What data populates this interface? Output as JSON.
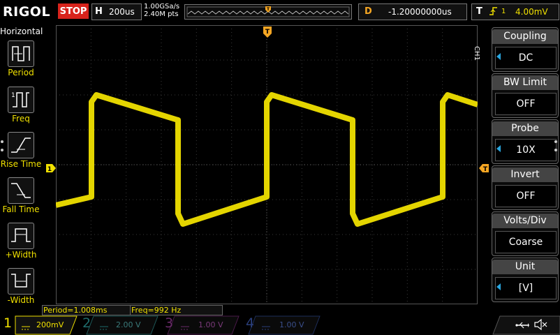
{
  "top": {
    "logo": "RIGOL",
    "run_status": "STOP",
    "timebase_key": "H",
    "timebase_value": "200us",
    "sample_rate": "1.00GSa/s",
    "memory_depth": "2.40M pts",
    "delay_key": "D",
    "delay_value": "-1.20000000us",
    "trigger_key": "T",
    "trigger_source": "1",
    "trigger_level": "4.00mV"
  },
  "left_menu": {
    "title": "Horizontal",
    "items": [
      {
        "label": "Period"
      },
      {
        "label": "Freq"
      },
      {
        "label": "Rise Time"
      },
      {
        "label": "Fall Time"
      },
      {
        "label": "+Width"
      },
      {
        "label": "-Width"
      }
    ]
  },
  "right_menu": {
    "channel": "CH1",
    "items": [
      {
        "title": "Coupling",
        "value": "DC"
      },
      {
        "title": "BW Limit",
        "value": "OFF"
      },
      {
        "title": "Probe",
        "value": "10X"
      },
      {
        "title": "Invert",
        "value": "OFF"
      },
      {
        "title": "Volts/Div",
        "value": "Coarse"
      },
      {
        "title": "Unit",
        "value": "[V]"
      }
    ]
  },
  "measurements": {
    "period": "Period=1.008ms",
    "freq": "Freq=992 Hz"
  },
  "channels": [
    {
      "num": "1",
      "scale": "200mV",
      "color": "#f0e000"
    },
    {
      "num": "2",
      "scale": "2.00 V",
      "color": "#00c8c8"
    },
    {
      "num": "3",
      "scale": "1.00 V",
      "color": "#d040d0"
    },
    {
      "num": "4",
      "scale": "1.00 V",
      "color": "#2a6cd8"
    }
  ],
  "markers": {
    "trigger_pos": "T",
    "channel_ground": "1",
    "trigger_level_marker": "T"
  },
  "colors": {
    "ch1": "#f0e000",
    "stop": "#d8231c",
    "trigger_orange": "#f5a623",
    "menu_arrow": "#2aa7e0"
  }
}
